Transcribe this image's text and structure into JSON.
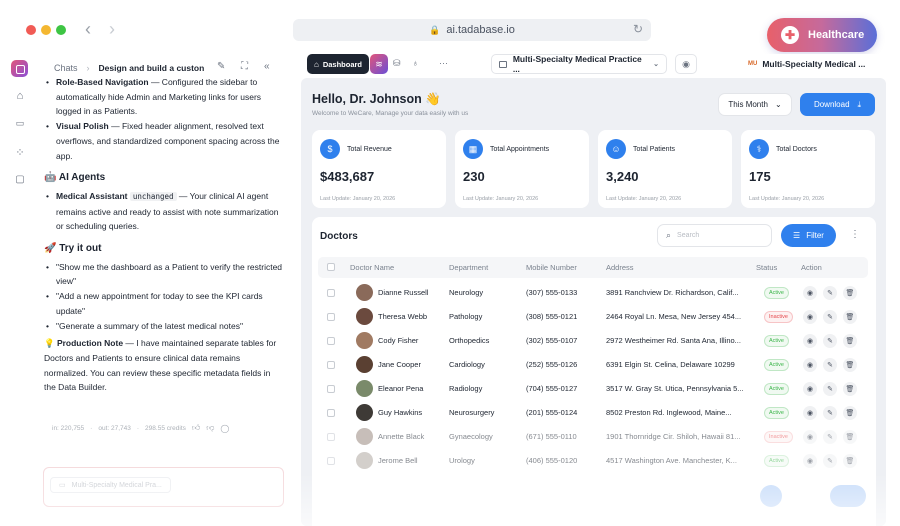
{
  "browser": {
    "url": "ai.tadabase.io",
    "badge_label": "Healthcare"
  },
  "chat": {
    "breadcrumb_root": "Chats",
    "title": "Design and build a custon",
    "lines": {
      "role_nav_title": "Role-Based Navigation",
      "role_nav_text": " — Configured the sidebar to automatically hide Admin and Marketing links for users logged in as Patients.",
      "visual_polish_title": "Visual Polish",
      "visual_polish_text": " — Fixed header alignment, resolved text overflows, and standardized component spacing across the app.",
      "ai_agents_heading": "🤖 AI Agents",
      "medical_assistant_title": "Medical Assistant",
      "medical_assistant_code": "unchanged",
      "medical_assistant_text": " — Your clinical AI agent remains active and ready to assist with note summarization or scheduling queries.",
      "try_heading": "🚀 Try it out",
      "try_1": "\"Show me the dashboard as a Patient to verify the restricted view\"",
      "try_2": "\"Add a new appointment for today to see the KPI cards update\"",
      "try_3": "\"Generate a summary of the latest medical notes\"",
      "production_title": "💡 Production Note",
      "production_text": " — I have maintained separate tables for Doctors and Patients to ensure clinical data remains normalized. You can review these specific metadata fields in the Data Builder."
    },
    "meta": {
      "tokens_in": "in: 220,755",
      "tokens_out": "out: 27,743",
      "credits": "298.55 credits"
    },
    "input_chip": "Multi-Specialty Medical Pra..."
  },
  "toolbar": {
    "dashboard_tab": "Dashboard",
    "page_select": "Multi-Specialty Medical Practice ...",
    "app_select": "Multi-Specialty Medical ...",
    "app_logo_text": "MU"
  },
  "dashboard": {
    "greeting": "Hello, Dr. Johnson 👋",
    "subtitle": "Welcome to WeCare, Manage your data easily with us",
    "period": "This Month",
    "download": "Download",
    "kpis": [
      {
        "label": "Total Revenue",
        "value": "$483,687",
        "updated": "Last Update: January 20, 2026"
      },
      {
        "label": "Total Appointments",
        "value": "230",
        "updated": "Last Update: January 20, 2026"
      },
      {
        "label": "Total Patients",
        "value": "3,240",
        "updated": "Last Update: January 20, 2026"
      },
      {
        "label": "Total Doctors",
        "value": "175",
        "updated": "Last Update: January 20, 2026"
      }
    ],
    "table": {
      "title": "Doctors",
      "search_placeholder": "Search",
      "filter": "Filter",
      "columns": [
        "Doctor Name",
        "Department",
        "Mobile Number",
        "Address",
        "Status",
        "Action"
      ],
      "rows": [
        {
          "name": "Dianne Russell",
          "department": "Neurology",
          "mobile": "(307) 555-0133",
          "address": "3891 Ranchview Dr. Richardson, Calif...",
          "status": "Active"
        },
        {
          "name": "Theresa Webb",
          "department": "Pathology",
          "mobile": "(308) 555-0121",
          "address": "2464 Royal Ln. Mesa, New Jersey 454...",
          "status": "Inactive"
        },
        {
          "name": "Cody Fisher",
          "department": "Orthopedics",
          "mobile": "(302) 555-0107",
          "address": "2972 Westheimer Rd. Santa Ana, Illino...",
          "status": "Active"
        },
        {
          "name": "Jane Cooper",
          "department": "Cardiology",
          "mobile": "(252) 555-0126",
          "address": "6391 Elgin St. Celina, Delaware 10299",
          "status": "Active"
        },
        {
          "name": "Eleanor Pena",
          "department": "Radiology",
          "mobile": "(704) 555-0127",
          "address": "3517 W. Gray St. Utica, Pennsylvania 5...",
          "status": "Active"
        },
        {
          "name": "Guy Hawkins",
          "department": "Neurosurgery",
          "mobile": "(201) 555-0124",
          "address": "8502 Preston Rd. Inglewood, Maine...",
          "status": "Active"
        },
        {
          "name": "Annette Black",
          "department": "Gynaecology",
          "mobile": "(671) 555-0110",
          "address": "1901 Thornridge Cir. Shiloh, Hawaii 81...",
          "status": "Inactive"
        },
        {
          "name": "Jerome Bell",
          "department": "Urology",
          "mobile": "(406) 555-0120",
          "address": "4517 Washington Ave. Manchester, K...",
          "status": "Active"
        }
      ]
    }
  },
  "colors": {
    "accent": "#2f80ed",
    "active": "#3bb54a",
    "inactive": "#e5484d"
  }
}
